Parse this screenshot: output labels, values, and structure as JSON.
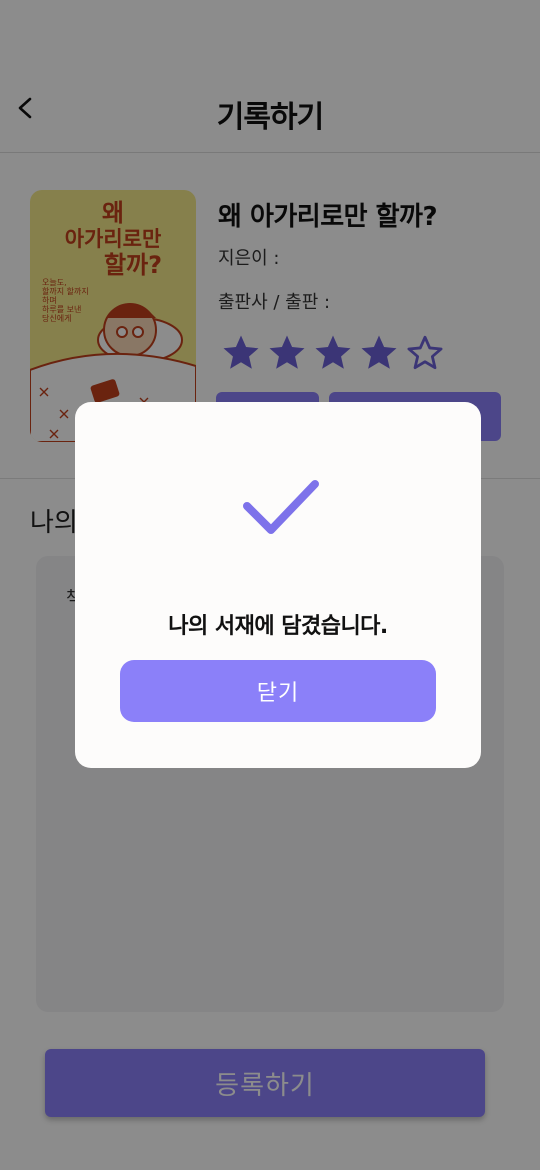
{
  "header": {
    "title": "기록하기"
  },
  "book": {
    "title": "왜 아가리로만 할까?",
    "author_label": "지은이 :",
    "publisher_label": "출판사 / 출판 :",
    "rating": 4,
    "rating_max": 5,
    "cover_title_line1": "왜",
    "cover_title_line2": "아가리로만",
    "cover_title_line3": "할까?",
    "cover_subtitle_1": "오늘도,",
    "cover_subtitle_2": "할까지 할까지",
    "cover_subtitle_3": "하며",
    "cover_subtitle_4": "하루를 보낸",
    "cover_subtitle_5": "당신에게"
  },
  "note": {
    "section_label": "나의",
    "placeholder": "책"
  },
  "register_button": "등록하기",
  "modal": {
    "message": "나의 서재에 담겼습니다.",
    "close_label": "닫기"
  },
  "colors": {
    "accent": "#8b80f9",
    "star": "#6c61d8",
    "overlay": "rgba(0,0,0,0.45)"
  }
}
